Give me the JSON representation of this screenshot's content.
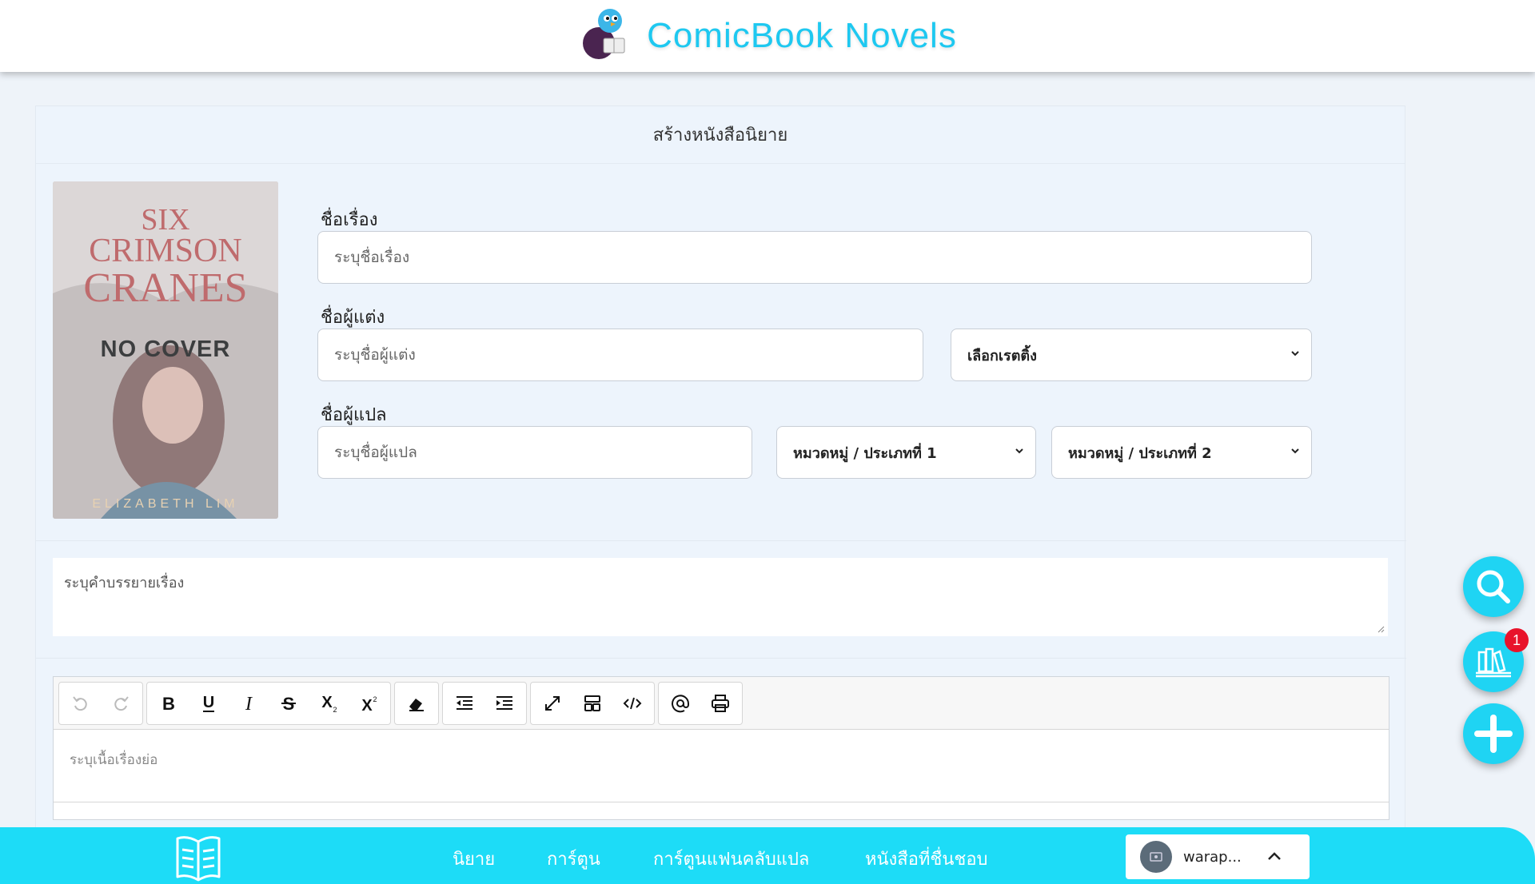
{
  "header": {
    "brand_name": "ComicBook Novels"
  },
  "form": {
    "title": "สร้างหนังสือนิยาย",
    "cover_label": "NO COVER",
    "story_name": {
      "label": "ชื่อเรื่อง",
      "placeholder": "ระบุชื่อเรื่อง"
    },
    "author": {
      "label": "ชื่อผู้แต่ง",
      "placeholder": "ระบุชื่อผู้แต่ง"
    },
    "rating_select": "เลือกเรตติ้ง",
    "translator": {
      "label": "ชื่อผู้แปล",
      "placeholder": "ระบุชื่อผู้แปล"
    },
    "category1": "หมวดหมู่ / ประเภทที่ 1",
    "category2": "หมวดหมู่ / ประเภทที่ 2",
    "description_placeholder": "ระบุคำบรรยายเรื่อง",
    "synopsis_placeholder": "ระบุเนื้อเรื่องย่อ"
  },
  "toolbar": {
    "groups": [
      [
        "undo-icon",
        "redo-icon"
      ],
      [
        "bold-icon",
        "underline-icon",
        "italic-icon",
        "strikethrough-icon",
        "subscript-icon",
        "superscript-icon"
      ],
      [
        "eraser-icon"
      ],
      [
        "outdent-icon",
        "indent-icon"
      ],
      [
        "fullscreen-icon",
        "template-icon",
        "code-icon"
      ],
      [
        "mention-icon",
        "print-icon"
      ]
    ]
  },
  "fab": {
    "library_badge": "1"
  },
  "bottom_nav": {
    "items": [
      "นิยาย",
      "การ์ตูน",
      "การ์ตูนแฟนคลับแปล",
      "หนังสือที่ชื่นชอบ"
    ],
    "user_name": "warap..."
  },
  "colors": {
    "accent": "#1ddcf7",
    "brand": "#1ec8f0",
    "badge": "#e8132b"
  }
}
